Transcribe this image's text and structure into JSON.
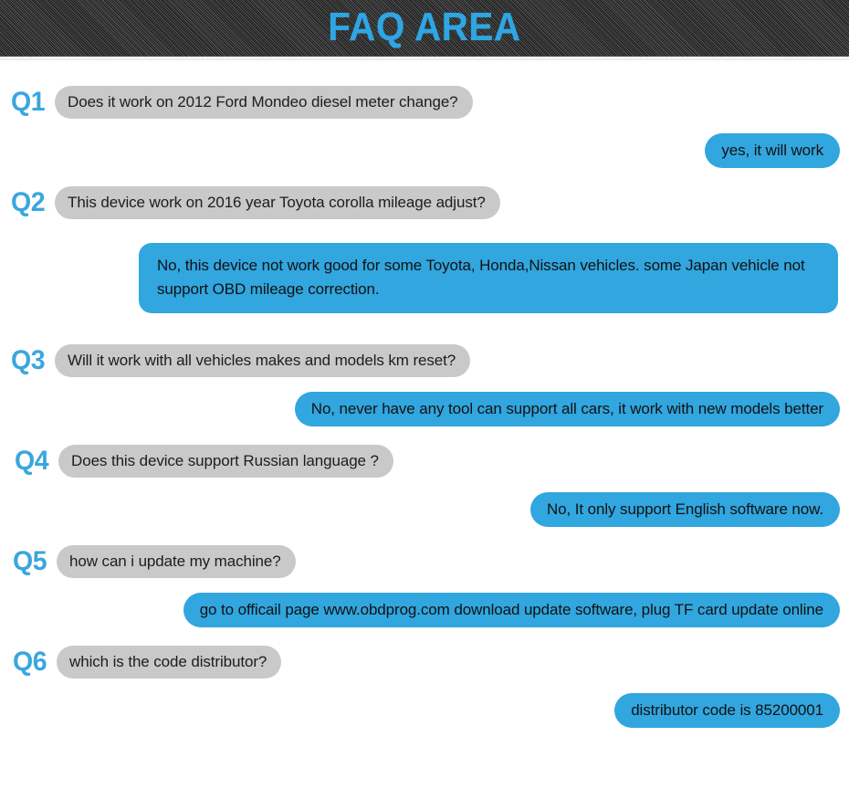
{
  "header": {
    "title": "FAQ AREA",
    "accent_color": "#2fa6e3",
    "band_color": "#3b3b3b"
  },
  "theme": {
    "question_bubble_color": "#c9c9c9",
    "answer_bubble_color": "#31a6df",
    "q_label_color": "#3aa6df",
    "text_color": "#1d1d1d"
  },
  "faq": {
    "items": [
      {
        "label": "Q1",
        "question": "Does it work on 2012 Ford Mondeo diesel meter change?",
        "answer": "yes, it will work"
      },
      {
        "label": "Q2",
        "question": "This device work on 2016 year Toyota corolla mileage adjust?",
        "answer": "No, this device not work good for some Toyota, Honda,Nissan vehicles. some Japan vehicle not support OBD mileage correction."
      },
      {
        "label": "Q3",
        "question": "Will it work with all vehicles makes and models km reset?",
        "answer": "No, never have any tool can support all cars, it work with new models better"
      },
      {
        "label": "Q4",
        "question": "Does this device support Russian language ?",
        "answer": "No, It only support English software now."
      },
      {
        "label": "Q5",
        "question": "how can i update my machine?",
        "answer": "go to officail page www.obdprog.com download update software, plug TF card update online"
      },
      {
        "label": "Q6",
        "question": "which is the code distributor?",
        "answer": "distributor code is 85200001"
      }
    ]
  }
}
